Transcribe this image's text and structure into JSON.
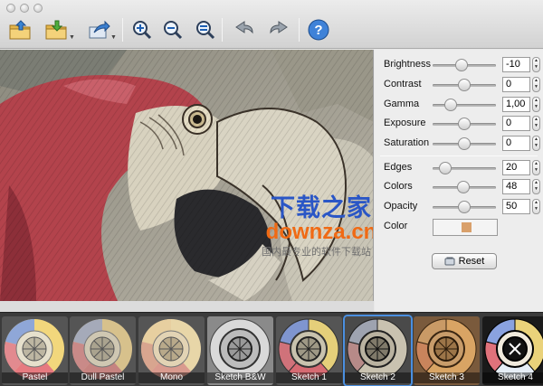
{
  "toolbar": {
    "buttons": [
      {
        "icon": "open-folder-icon"
      },
      {
        "icon": "save-folder-icon"
      },
      {
        "icon": "share-icon"
      },
      {
        "icon": "zoom-in-icon"
      },
      {
        "icon": "zoom-out-icon"
      },
      {
        "icon": "zoom-fit-icon"
      },
      {
        "icon": "undo-icon"
      },
      {
        "icon": "redo-icon"
      },
      {
        "icon": "help-icon",
        "label": "?"
      }
    ]
  },
  "watermark": {
    "title": "下载之家",
    "domain": "downza.cn",
    "slogan": "国内最专业的软件下载站！"
  },
  "adjustments": [
    {
      "label": "Brightness",
      "value": "-10",
      "level": 0.45
    },
    {
      "label": "Contrast",
      "value": "0",
      "level": 0.5
    },
    {
      "label": "Gamma",
      "value": "1,00",
      "level": 0.28
    },
    {
      "label": "Exposure",
      "value": "0",
      "level": 0.5
    },
    {
      "label": "Saturation",
      "value": "0",
      "level": 0.5
    }
  ],
  "sketch": [
    {
      "label": "Edges",
      "value": "20",
      "level": 0.2
    },
    {
      "label": "Colors",
      "value": "48",
      "level": 0.48
    },
    {
      "label": "Opacity",
      "value": "50",
      "level": 0.5
    }
  ],
  "color": {
    "label": "Color",
    "swatch": "#d9a06b"
  },
  "reset": {
    "label": "Reset"
  },
  "presets": [
    {
      "label": "Pastel",
      "selected": false
    },
    {
      "label": "Dull Pastel",
      "selected": false
    },
    {
      "label": "Mono",
      "selected": false
    },
    {
      "label": "Sketch B&W",
      "selected": false
    },
    {
      "label": "Sketch 1",
      "selected": false
    },
    {
      "label": "Sketch 2",
      "selected": true
    },
    {
      "label": "Sketch 3",
      "selected": false
    },
    {
      "label": "Sketch 4",
      "selected": false
    }
  ]
}
